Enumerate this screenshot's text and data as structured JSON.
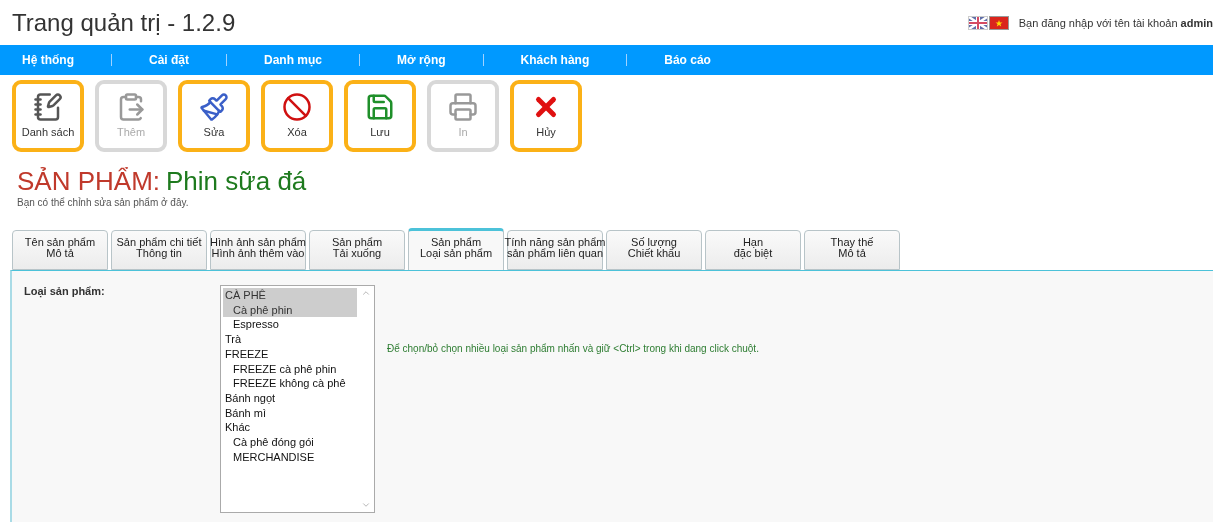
{
  "header": {
    "title": "Trang quản trị - 1.2.9",
    "login_text": "Bạn đăng nhập với tên tài khoản",
    "username": "admin",
    "languages": [
      {
        "kind": "uk",
        "selected": false
      },
      {
        "kind": "vn",
        "selected": true
      }
    ]
  },
  "menu": [
    "Hệ thống",
    "Cài đặt",
    "Danh mục",
    "Mở rộng",
    "Khách hàng",
    "Báo cáo"
  ],
  "toolbar": [
    {
      "kind": "list",
      "label": "Danh sách",
      "disabled": false
    },
    {
      "kind": "add",
      "label": "Thêm",
      "disabled": true
    },
    {
      "kind": "edit",
      "label": "Sửa",
      "disabled": false
    },
    {
      "kind": "delete",
      "label": "Xóa",
      "disabled": false
    },
    {
      "kind": "save",
      "label": "Lưu",
      "disabled": false
    },
    {
      "kind": "print",
      "label": "In",
      "disabled": true
    },
    {
      "kind": "cancel",
      "label": "Hủy",
      "disabled": false
    }
  ],
  "heading": {
    "prefix": "SẢN PHẨM:",
    "name": "Phin sữa đá",
    "subtitle": "Bạn có thể chỉnh sửa sản phẩm ở đây."
  },
  "tabs": [
    {
      "lines": [
        "Tên sản phẩm",
        "Mô tả"
      ],
      "selected": false
    },
    {
      "lines": [
        "Sản phẩm chi tiết",
        "Thông tin"
      ],
      "selected": false
    },
    {
      "lines": [
        "Hình ảnh sản phẩm",
        "Hình ảnh thêm vào"
      ],
      "selected": false
    },
    {
      "lines": [
        "Sản phẩm",
        "Tải xuống"
      ],
      "selected": false
    },
    {
      "lines": [
        "Sản phẩm",
        "Loại sản phẩm"
      ],
      "selected": true
    },
    {
      "lines": [
        "Tính năng sản phẩm",
        "sản phẩm liên quan"
      ],
      "selected": false
    },
    {
      "lines": [
        "Số lượng",
        "Chiết khấu"
      ],
      "selected": false
    },
    {
      "lines": [
        "Hạn",
        "đặc biệt"
      ],
      "selected": false
    },
    {
      "lines": [
        "Thay thế",
        "Mô tả"
      ],
      "selected": false
    }
  ],
  "form": {
    "label": "Loại sản phẩm:",
    "hint": "Để chọn/bỏ chọn nhiều loại sản phẩm nhấn và giữ <Ctrl> trong khi dang click chuột.",
    "categories": [
      {
        "label": "CÀ PHÊ",
        "selected": true,
        "children": [
          {
            "label": "Cà phê phin",
            "selected": true
          },
          {
            "label": "Espresso",
            "selected": false
          }
        ]
      },
      {
        "label": "Trà",
        "selected": false
      },
      {
        "label": "FREEZE",
        "selected": false,
        "children": [
          {
            "label": "FREEZE cà phê phin",
            "selected": false
          },
          {
            "label": "FREEZE không cà phê",
            "selected": false
          }
        ]
      },
      {
        "label": "Bánh ngọt",
        "selected": false
      },
      {
        "label": "Bánh mì",
        "selected": false
      },
      {
        "label": "Khác",
        "selected": false,
        "children": [
          {
            "label": "Cà phê đóng gói",
            "selected": false
          },
          {
            "label": "MERCHANDISE",
            "selected": false
          }
        ]
      }
    ]
  }
}
